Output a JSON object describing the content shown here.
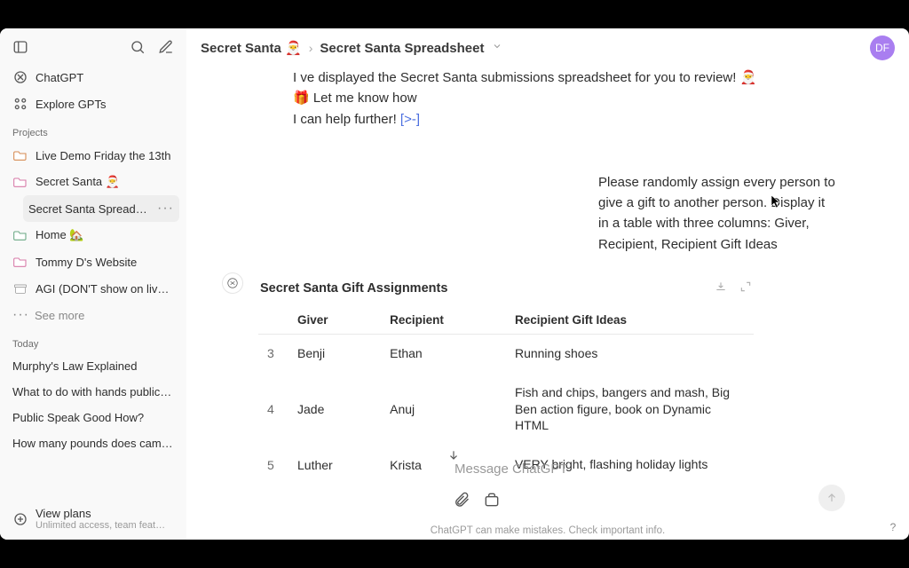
{
  "breadcrumbs": {
    "project": "Secret Santa 🎅",
    "page": "Secret Santa Spreadsheet"
  },
  "avatar": "DF",
  "sidebar": {
    "nav": {
      "chatgpt": "ChatGPT",
      "explore": "Explore GPTs"
    },
    "sections": {
      "projects_label": "Projects",
      "today_label": "Today"
    },
    "projects": [
      {
        "label": "Live Demo Friday the 13th",
        "color": "orange"
      },
      {
        "label": "Secret Santa 🎅",
        "color": "pink"
      }
    ],
    "sub_page": "Secret Santa Spreadshee",
    "projects_rest": [
      {
        "label": "Home 🏡",
        "color": "green"
      },
      {
        "label": "Tommy D's Website",
        "color": "pink"
      },
      {
        "label": "AGI (DON'T show on live…",
        "color": "grey"
      }
    ],
    "see_more": "See more",
    "today": [
      "Murphy's Law Explained",
      "What to do with hands public sp",
      "Public Speak Good How?",
      "How many pounds does camera"
    ],
    "plans": {
      "title": "View plans",
      "subtitle": "Unlimited access, team feature"
    }
  },
  "asst_intro_line1": "I ve displayed the Secret Santa submissions spreadsheet for you to review! 🎅🎁 Let me know how",
  "asst_intro_line2": "I can help further!",
  "asst_intro_link": "[>-]",
  "user_msg": "Please randomly assign every person to give a gift to another person. Display it in a table with three columns: Giver, Recipient, Recipient Gift Ideas",
  "table": {
    "title": "Secret Santa Gift Assignments",
    "columns": [
      "",
      "Giver",
      "Recipient",
      "Recipient Gift Ideas"
    ],
    "rows": [
      {
        "n": "3",
        "giver": "Benji",
        "recipient": "Ethan",
        "ideas": "Running shoes"
      },
      {
        "n": "4",
        "giver": "Jade",
        "recipient": "Anuj",
        "ideas": "Fish and chips, bangers and mash, Big Ben action figure, book on Dynamic HTML"
      },
      {
        "n": "5",
        "giver": "Luther",
        "recipient": "Krista",
        "ideas": "VERY bright, flashing holiday lights"
      }
    ]
  },
  "composer": {
    "placeholder": "Message ChatGPT"
  },
  "footer": "ChatGPT can make mistakes. Check important info.",
  "help": "?"
}
